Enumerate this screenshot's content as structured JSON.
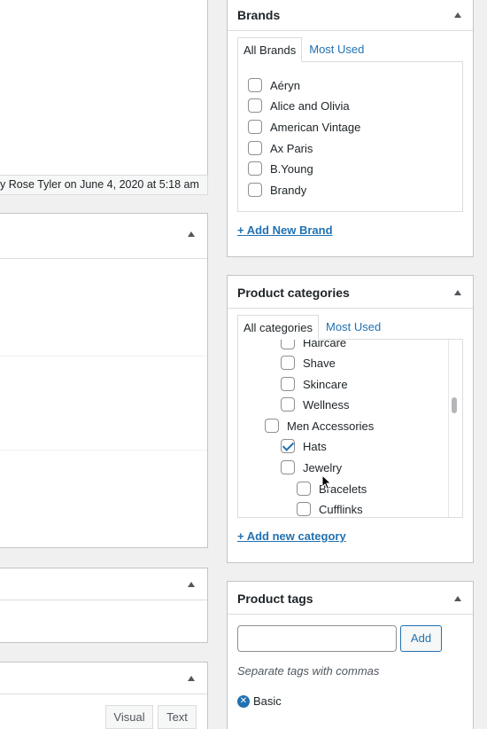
{
  "last_edit": {
    "text": "y Rose Tyler on June 4, 2020 at 5:18 am"
  },
  "editor": {
    "visual_label": "Visual",
    "text_label": "Text"
  },
  "brands": {
    "title": "Brands",
    "tab_all": "All Brands",
    "tab_most_used": "Most Used",
    "items": [
      {
        "label": "Aéryn",
        "checked": false
      },
      {
        "label": "Alice and Olivia",
        "checked": false
      },
      {
        "label": "American Vintage",
        "checked": false
      },
      {
        "label": "Ax Paris",
        "checked": false
      },
      {
        "label": "B.Young",
        "checked": false
      },
      {
        "label": "Brandy",
        "checked": false
      }
    ],
    "add_link": "+ Add New Brand"
  },
  "categories": {
    "title": "Product categories",
    "tab_all": "All categories",
    "tab_most_used": "Most Used",
    "items": [
      {
        "label": "Haircare",
        "checked": false,
        "level": 2
      },
      {
        "label": "Shave",
        "checked": false,
        "level": 2
      },
      {
        "label": "Skincare",
        "checked": false,
        "level": 2
      },
      {
        "label": "Wellness",
        "checked": false,
        "level": 2
      },
      {
        "label": "Men Accessories",
        "checked": false,
        "level": 1
      },
      {
        "label": "Hats",
        "checked": true,
        "level": 2
      },
      {
        "label": "Jewelry",
        "checked": false,
        "level": 2
      },
      {
        "label": "Bracelets",
        "checked": false,
        "level": 3
      },
      {
        "label": "Cufflinks",
        "checked": false,
        "level": 3
      }
    ],
    "add_link": "+ Add new category"
  },
  "tags": {
    "title": "Product tags",
    "input_value": "",
    "add_button": "Add",
    "hint": "Separate tags with commas",
    "items": [
      "Basic"
    ]
  }
}
